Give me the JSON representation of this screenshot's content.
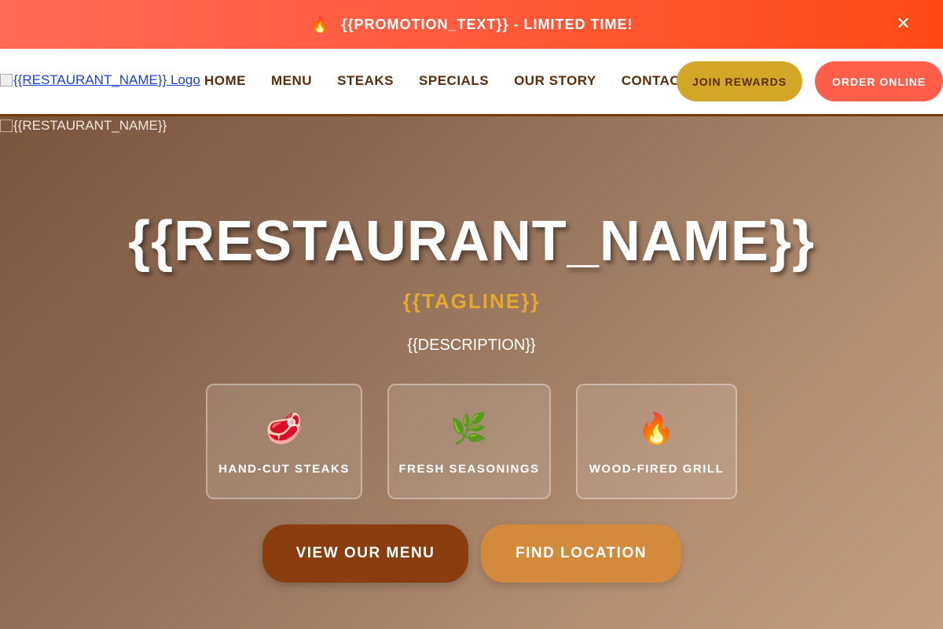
{
  "promo": {
    "icon": "fire-icon",
    "text": "{{PROMOTION_TEXT}} - LIMITED TIME!",
    "close": "✕"
  },
  "nav": {
    "logo_alt": "{{RESTAURANT_NAME}} Logo",
    "links": [
      "HOME",
      "MENU",
      "STEAKS",
      "SPECIALS",
      "OUR STORY",
      "CONTACT"
    ],
    "rewards_label": "JOIN REWARDS",
    "order_label": "ORDER ONLINE"
  },
  "hero": {
    "image_alt": "{{RESTAURANT_NAME}}",
    "title": "{{RESTAURANT_NAME}}",
    "tagline": "{{TAGLINE}}",
    "description": "{{DESCRIPTION}}",
    "features": [
      {
        "icon": "steak-icon",
        "glyph": "🥩",
        "label": "HAND-CUT STEAKS"
      },
      {
        "icon": "herb-icon",
        "glyph": "🌿",
        "label": "FRESH SEASONINGS"
      },
      {
        "icon": "fire-icon",
        "glyph": "🔥",
        "label": "WOOD-FIRED GRILL"
      }
    ],
    "primary_button": "VIEW OUR MENU",
    "secondary_button": "FIND LOCATION"
  },
  "colors": {
    "promo": "#ff5a3c",
    "brand_brown": "#8a3e10",
    "gold": "#d4a628",
    "coral": "#ff5e4a",
    "amber": "#d48a3c"
  }
}
